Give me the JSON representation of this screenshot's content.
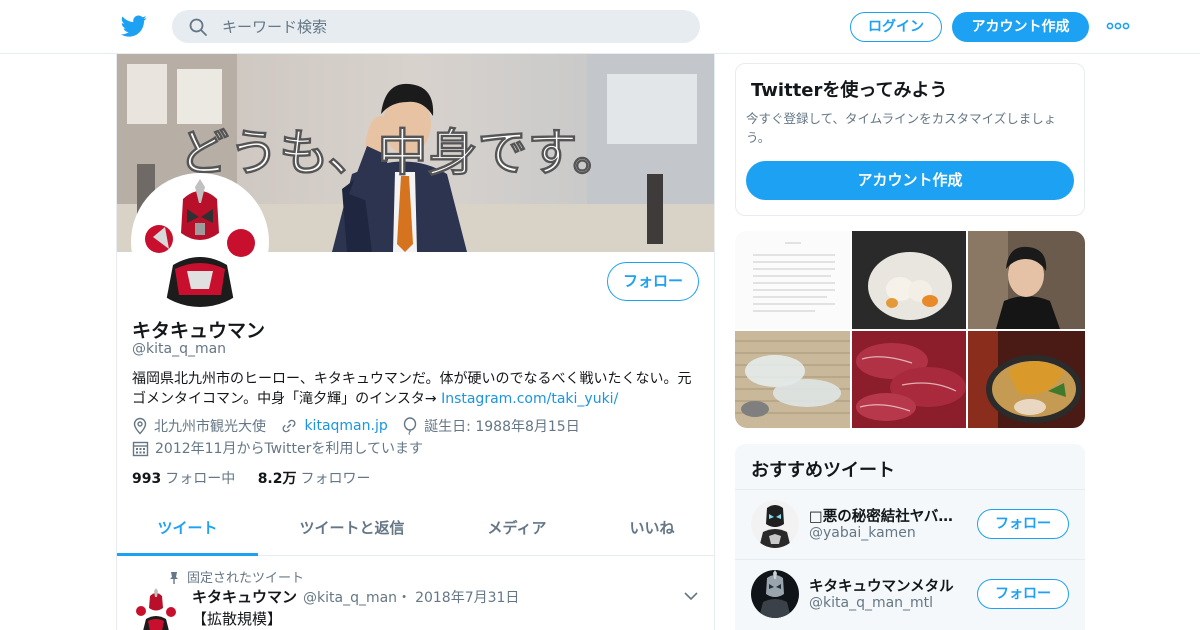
{
  "header": {
    "search_placeholder": "キーワード検索",
    "login_label": "ログイン",
    "signup_label": "アカウント作成"
  },
  "profile": {
    "banner_text": "どうも、中身です。",
    "follow_label": "フォロー",
    "display_name": "キタキュウマン",
    "handle": "@kita_q_man",
    "bio_text": "福岡県北九州市のヒーロー、キタキュウマンだ。体が硬いのでなるべく戦いたくない。元ゴメンタイコマン。中身「滝夕輝」のインスタ→",
    "bio_link": "Instagram.com/taki_yuki/",
    "location": "北九州市観光大使",
    "website": "kitaqman.jp",
    "birthday": "誕生日: 1988年8月15日",
    "joined": "2012年11月からTwitterを利用しています",
    "following_count": "993",
    "following_label": "フォロー中",
    "followers_count": "8.2万",
    "followers_label": "フォロワー"
  },
  "tabs": [
    "ツイート",
    "ツイートと返信",
    "メディア",
    "いいね"
  ],
  "pinned_tweet": {
    "label": "固定されたツイート",
    "name": "キタキュウマン",
    "handle": "@kita_q_man",
    "separator": "・",
    "date": "2018年7月31日",
    "text": "【拡散規模】"
  },
  "signup_card": {
    "title": "Twitterを使ってみよう",
    "description": "今すぐ登録して、タイムラインをカスタマイズしましょう。",
    "button_label": "アカウント作成"
  },
  "recommended": {
    "title": "おすすめツイート",
    "follow_label": "フォロー",
    "accounts": [
      {
        "name": "□悪の秘密結社ヤバ…",
        "handle": "@yabai_kamen"
      },
      {
        "name": "キタキュウマンメタル",
        "handle": "@kita_q_man_mtl"
      }
    ]
  },
  "colors": {
    "accent": "#1da1f2",
    "link": "#1b95e0",
    "muted": "#657786",
    "text": "#14171a",
    "border": "#e6ecf0"
  },
  "icons": [
    "twitter-bird-icon",
    "search-icon",
    "more-dots-icon",
    "location-pin-icon",
    "link-icon",
    "balloon-icon",
    "calendar-icon",
    "pin-icon",
    "chevron-down-icon"
  ]
}
